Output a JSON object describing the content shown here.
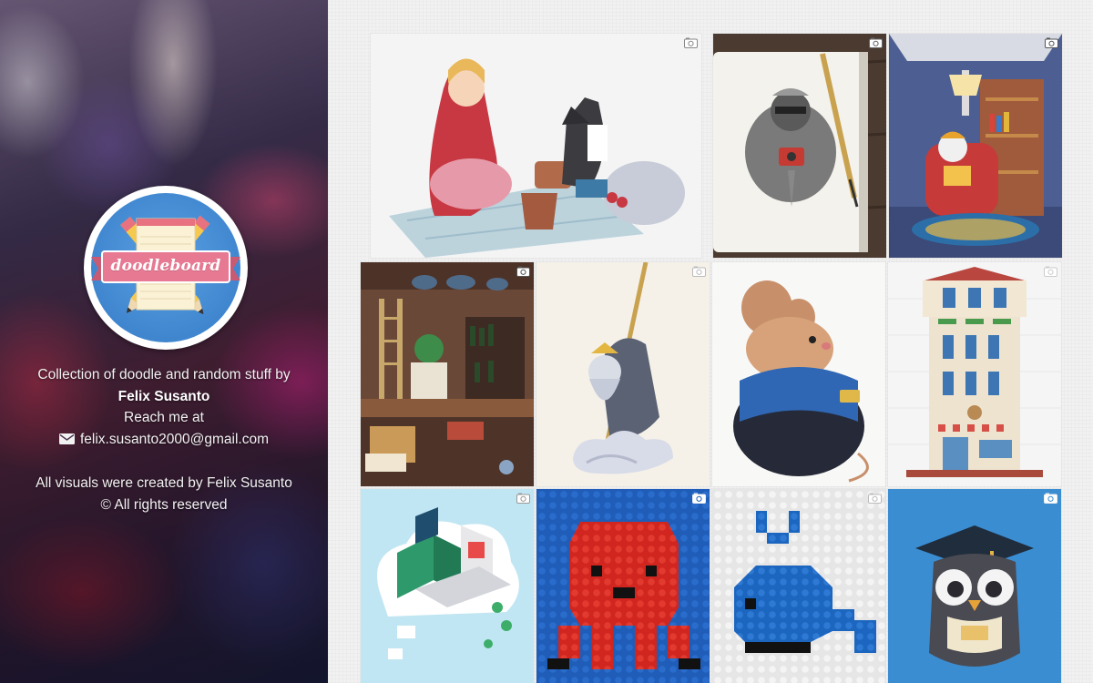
{
  "site": {
    "logo_text": "doodleboard",
    "tagline": "Collection of doodle and random stuff by",
    "author": "Felix Susanto",
    "reach_text": "Reach me at",
    "email": "felix.susanto2000@gmail.com",
    "credit": "All visuals were created by Felix Susanto",
    "rights": "© All rights reserved"
  },
  "icons": {
    "email": "envelope-icon",
    "gallery_badge": "camera-icon"
  },
  "colors": {
    "logo_blue": "#4a8fd6",
    "ribbon_pink": "#e87993",
    "gallery_bg": "#f1f1f1"
  },
  "gallery": {
    "items": [
      {
        "subject": "red-riding-hood-picnic"
      },
      {
        "subject": "gorilla-sketchbook"
      },
      {
        "subject": "reading-room"
      },
      {
        "subject": "frog-shopkeeper"
      },
      {
        "subject": "wizard-on-cloud"
      },
      {
        "subject": "round-mouse"
      },
      {
        "subject": "townhouse"
      },
      {
        "subject": "isometric-city"
      },
      {
        "subject": "lego-octopus"
      },
      {
        "subject": "lego-whale"
      },
      {
        "subject": "graduate-owl"
      }
    ]
  }
}
